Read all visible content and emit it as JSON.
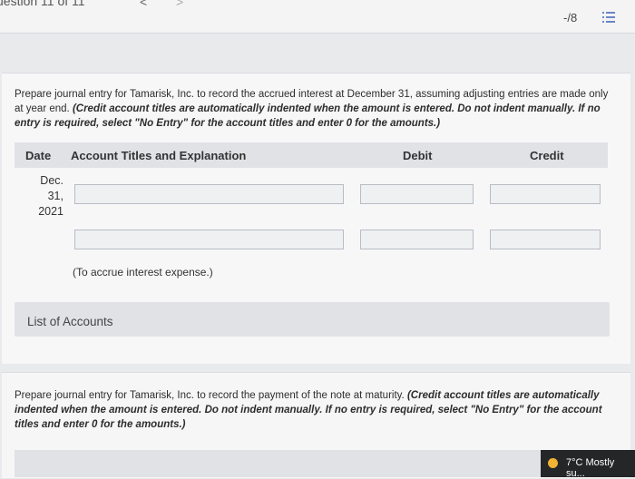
{
  "topbar": {
    "question_counter": "uestion 11 of 11",
    "prev_label": "<",
    "next_label": ">",
    "score": "-/8",
    "list_icon": "list-icon"
  },
  "part1": {
    "prompt_plain": "Prepare journal entry for Tamarisk, Inc. to record the accrued interest at December 31, assuming adjusting entries are made only at year end.",
    "prompt_instructions": "(Credit account titles are automatically indented when the amount is entered. Do not indent manually. If no entry is required, select \"No Entry\" for the account titles and enter 0 for the amounts.)",
    "table_headers": {
      "date": "Date",
      "account": "Account Titles and Explanation",
      "debit": "Debit",
      "credit": "Credit"
    },
    "date": [
      "Dec.",
      "31,",
      "2021"
    ],
    "rows": [
      {
        "account": "",
        "debit": "",
        "credit": ""
      },
      {
        "account": "",
        "debit": "",
        "credit": ""
      }
    ],
    "explanation": "(To accrue interest expense.)",
    "list_of_accounts": "List of Accounts"
  },
  "part2": {
    "prompt_plain": "Prepare journal entry for Tamarisk, Inc. to record the payment of the note at maturity.",
    "prompt_instructions": "(Credit account titles are automatically indented when the amount is entered. Do not indent manually. If no entry is required, select \"No Entry\" for the account titles and enter 0 for the amounts.)"
  },
  "taskbar": {
    "weather": "7°C  Mostly su..."
  },
  "colors": {
    "page_bg": "#e9eaec",
    "header_bg": "#e1e2e6",
    "field_bg": "#eef0f1",
    "field_border": "#b8bcc4"
  }
}
